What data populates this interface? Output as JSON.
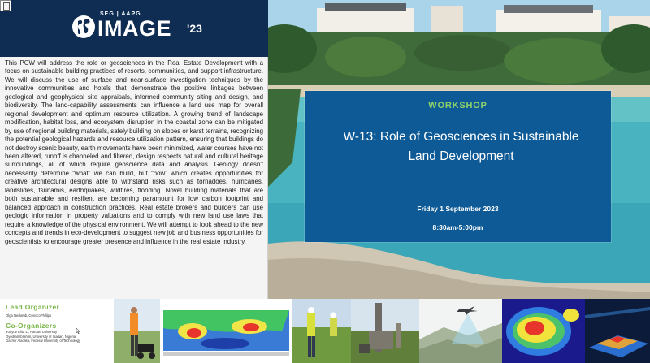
{
  "logo": {
    "top_line": "SEG | AAPG",
    "word": "IMAGE",
    "year": "'23"
  },
  "description": "This PCW will address the role or geosciences in the Real Estate Development with a focus on sustainable building practices of resorts, communities, and support infrastructure. We will discuss the use of surface and near-surface investigation techniques by the innovative communities and hotels that demonstrate the positive linkages between geological and geophysical site appraisals, informed community siting and design, and biodiversity.  The land-capability assessments can influence a land use map for overall regional development and optimum resource utilization. A growing trend of landscape modification, habitat loss, and ecosystem disruption in the coastal zone can be mitigated by use of regional building materials, safely building on slopes or karst terrains, recognizing the potential geological hazards and resource utilization pattern, ensuring that buildings do not destroy scenic beauty, earth movements have been minimized, water courses have not been altered, runoff is channeled and filtered, design respects natural and cultural heritage surroundings, all of which require geoscience data and analysis. Geology doesn't necessarily determine “what” we can build, but “how” which creates opportunities for creative architectural designs able to withstand risks such as tornadoes, hurricanes, landslides, tsunamis, earthquakes, wildfires, flooding. Novel building materials that are both sustainable and resilient are becoming paramount for low carbon footprint and balanced approach in construction practices. Real estate brokers and builders can use geologic information in property valuations and to comply with new land use laws that require a knowledge of the physical environment. We will attempt to look ahead to the new concepts and trends in eco-development to suggest new job and business opportunities for geoscientists to encourage greater presence and influence in the real estate industry.",
  "workshop": {
    "label": "WORKSHOP",
    "title": "W-13: Role of Geosciences in Sustainable Land Development",
    "date": "Friday 1 September 2023",
    "time": "8:30am-5:00pm"
  },
  "organizers": {
    "lead_heading": "Lead Organizer",
    "lead_name": "Olga Nedorub, ConocoPhillips",
    "co_heading": "Co-Organizers",
    "co_names": [
      "Yunyue Elita Li, Purdue University",
      "Oyedran Ibrahim, University of Ibadan, Nigeria",
      "Gazmir Alaolisa, Federal University of Technology"
    ]
  },
  "colors": {
    "navy": "#0f2d52",
    "card_blue": "#0d5a96",
    "green_accent": "#7ab648",
    "workshop_green": "#8fd16b"
  },
  "icons": [
    "globe-icon",
    "document-icon",
    "cursor-icon"
  ]
}
